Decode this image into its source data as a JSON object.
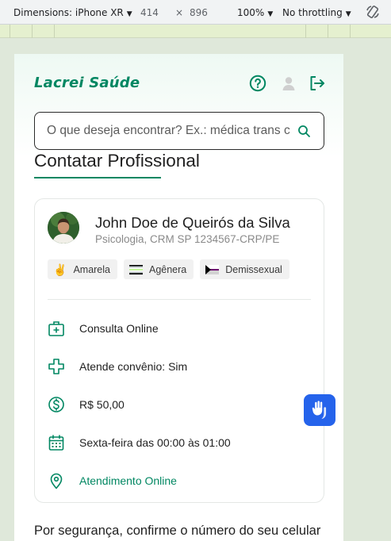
{
  "devtools": {
    "dimensions_label": "Dimensions: iPhone XR",
    "width": "414",
    "times": "×",
    "height": "896",
    "zoom": "100%",
    "throttling": "No throttling",
    "caret": "▼"
  },
  "header": {
    "brand": "Lacrei Saúde",
    "icons": [
      "help-icon",
      "user-icon",
      "logout-icon"
    ]
  },
  "search": {
    "placeholder": "O que deseja encontrar? Ex.: médica trans c",
    "value": ""
  },
  "page": {
    "title": "Contatar Profissional"
  },
  "professional": {
    "name": "John Doe de Queirós da Silva",
    "subtitle": "Psicologia, CRM SP 1234567-CRP/PE",
    "tags": [
      {
        "icon": "✌",
        "label": "Amarela"
      },
      {
        "icon": "agender-flag",
        "label": "Agênera"
      },
      {
        "icon": "demisexual-flag",
        "label": "Demissexual"
      }
    ],
    "details": [
      {
        "icon": "medical-kit-icon",
        "text": "Consulta Online"
      },
      {
        "icon": "health-cross-icon",
        "text": "Atende convênio: Sim"
      },
      {
        "icon": "dollar-icon",
        "text": "R$ 50,00"
      },
      {
        "icon": "calendar-icon",
        "text": "Sexta-feira das 00:00 às 01:00"
      },
      {
        "icon": "location-pin-icon",
        "text": "Atendimento Online"
      }
    ]
  },
  "footer": {
    "text": "Por segurança, confirme o número do seu celular"
  },
  "colors": {
    "brand_green": "#018762",
    "libras_blue": "#2563eb"
  }
}
